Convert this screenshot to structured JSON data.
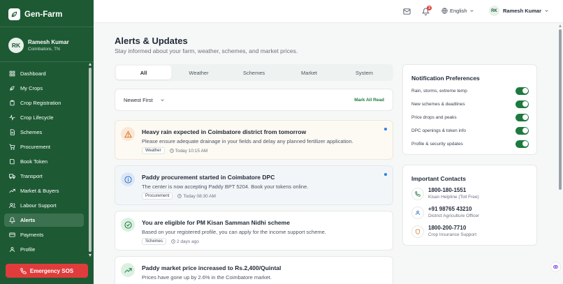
{
  "brand": {
    "name": "Gen-Farm"
  },
  "user": {
    "initials": "RK",
    "name": "Ramesh Kumar",
    "location": "Coimbatore, TN"
  },
  "nav": [
    {
      "label": "Dashboard",
      "icon": "dashboard-icon"
    },
    {
      "label": "My Crops",
      "icon": "leaf-icon"
    },
    {
      "label": "Crop Registration",
      "icon": "clipboard-icon"
    },
    {
      "label": "Crop Lifecycle",
      "icon": "activity-icon"
    },
    {
      "label": "Schemes",
      "icon": "document-icon"
    },
    {
      "label": "Procurement",
      "icon": "cart-icon"
    },
    {
      "label": "Book Token",
      "icon": "book-icon"
    },
    {
      "label": "Transport",
      "icon": "truck-icon"
    },
    {
      "label": "Market & Buyers",
      "icon": "trend-icon"
    },
    {
      "label": "Labour Support",
      "icon": "users-icon"
    },
    {
      "label": "Alerts",
      "icon": "bell-icon",
      "active": true
    },
    {
      "label": "Payments",
      "icon": "card-icon"
    },
    {
      "label": "Profile",
      "icon": "user-icon"
    }
  ],
  "sos": {
    "label": "Emergency SOS"
  },
  "topbar": {
    "notifications_count": "3",
    "language": "English",
    "user_initials": "RK",
    "user_name": "Ramesh Kumar"
  },
  "page": {
    "title": "Alerts & Updates",
    "subtitle": "Stay informed about your farm, weather, schemes, and market prices."
  },
  "tabs": [
    "All",
    "Weather",
    "Schemes",
    "Market",
    "System"
  ],
  "filter": {
    "sort": "Newest First",
    "mark_all": "Mark All Read"
  },
  "alerts": [
    {
      "title": "Heavy rain expected in Coimbatore district from tomorrow",
      "desc": "Please ensure adequate drainage in your fields and delay any planned fertilizer application.",
      "tag": "Weather",
      "time": "Today 10:15 AM",
      "icon": "warning-icon",
      "unread": true
    },
    {
      "title": "Paddy procurement started in Coimbatore DPC",
      "desc": "The center is now accepting Paddy BPT 5204. Book your tokens online.",
      "tag": "Procurement",
      "time": "Today 08:30 AM",
      "icon": "info-icon",
      "unread": true
    },
    {
      "title": "You are eligible for PM Kisan Samman Nidhi scheme",
      "desc": "Based on your registered profile, you can apply for the income support scheme.",
      "tag": "Schemes",
      "time": "2 days ago",
      "icon": "check-circle-icon",
      "unread": false
    },
    {
      "title": "Paddy market price increased to Rs.2,400/Quintal",
      "desc": "Prices have gone up by 2.6% in the Coimbatore market.",
      "tag": "Market",
      "time": "",
      "icon": "trend-up-icon",
      "unread": false
    }
  ],
  "preferences": {
    "title": "Notification Preferences",
    "items": [
      {
        "label": "Rain, storms, extreme temp",
        "on": true
      },
      {
        "label": "New schemes & deadlines",
        "on": true
      },
      {
        "label": "Price drops and peaks",
        "on": true
      },
      {
        "label": "DPC openings & token info",
        "on": true
      },
      {
        "label": "Profile & security updates",
        "on": true
      }
    ]
  },
  "contacts": {
    "title": "Important Contacts",
    "items": [
      {
        "number": "1800-180-1551",
        "label": "Kisan Helpline (Toll Free)",
        "icon": "phone-icon"
      },
      {
        "number": "+91 98765 43210",
        "label": "District Agriculture Officer",
        "icon": "user-icon"
      },
      {
        "number": "1800-200-7710",
        "label": "Crop Insurance Support",
        "icon": "shield-icon"
      }
    ]
  },
  "colors": {
    "brand": "#1d5a34",
    "accent": "#1d7a3e",
    "danger": "#e03c3c",
    "unread": "#2f7de1"
  }
}
